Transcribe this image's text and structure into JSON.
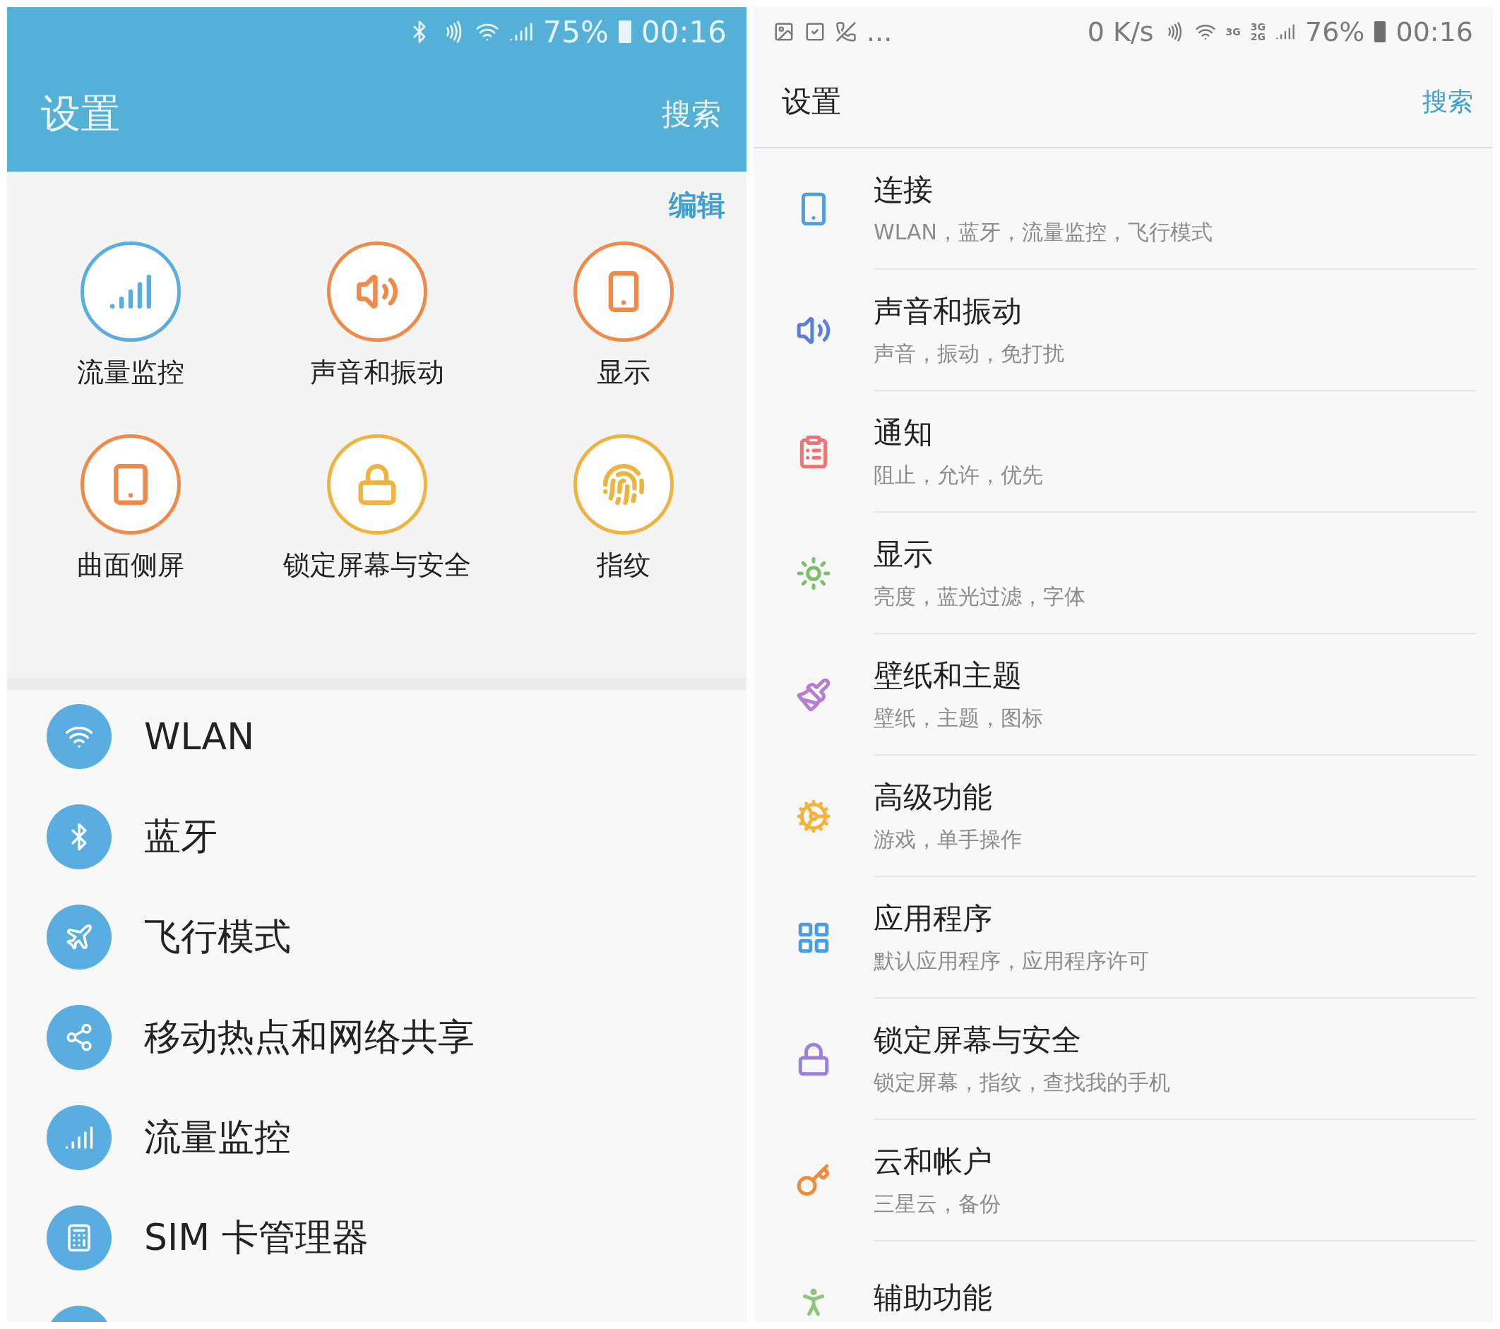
{
  "left": {
    "status_bar": {
      "battery": "75%",
      "time": "00:16"
    },
    "header": {
      "title": "设置",
      "search": "搜索"
    },
    "edit": "编辑",
    "quick_settings": [
      {
        "label": "流量监控",
        "color": "#5aade0"
      },
      {
        "label": "声音和振动",
        "color": "#ee8a4a"
      },
      {
        "label": "显示",
        "color": "#ee8a4a"
      },
      {
        "label": "曲面侧屏",
        "color": "#ee8a4a"
      },
      {
        "label": "锁定屏幕与安全",
        "color": "#efb33f"
      },
      {
        "label": "指纹",
        "color": "#efb33f"
      }
    ],
    "list": [
      {
        "label": "WLAN"
      },
      {
        "label": "蓝牙"
      },
      {
        "label": "飞行模式"
      },
      {
        "label": "移动热点和网络共享"
      },
      {
        "label": "流量监控"
      },
      {
        "label": "SIM 卡管理器"
      }
    ]
  },
  "right": {
    "status_bar": {
      "more": "...",
      "speed": "0 K/s",
      "network_1": "3G",
      "network_2_top": "3G",
      "network_2_bottom": "2G",
      "battery": "76%",
      "time": "00:16"
    },
    "header": {
      "title": "设置",
      "search": "搜索"
    },
    "items": [
      {
        "title": "连接",
        "subtitle": "WLAN，蓝牙，流量监控，飞行模式",
        "color": "#4f9fdc"
      },
      {
        "title": "声音和振动",
        "subtitle": "声音，振动，免打扰",
        "color": "#5a7fe0"
      },
      {
        "title": "通知",
        "subtitle": "阻止，允许，优先",
        "color": "#f07272"
      },
      {
        "title": "显示",
        "subtitle": "亮度，蓝光过滤，字体",
        "color": "#7cc06a"
      },
      {
        "title": "壁纸和主题",
        "subtitle": "壁纸，主题，图标",
        "color": "#b57fd0"
      },
      {
        "title": "高级功能",
        "subtitle": "游戏，单手操作",
        "color": "#f2b43c"
      },
      {
        "title": "应用程序",
        "subtitle": "默认应用程序，应用程序许可",
        "color": "#4a9de0"
      },
      {
        "title": "锁定屏幕与安全",
        "subtitle": "锁定屏幕，指纹，查找我的手机",
        "color": "#9b7fe0"
      },
      {
        "title": "云和帐户",
        "subtitle": "三星云，备份",
        "color": "#f08a3c"
      },
      {
        "title": "辅助功能",
        "color": "#8dc57a"
      }
    ]
  }
}
